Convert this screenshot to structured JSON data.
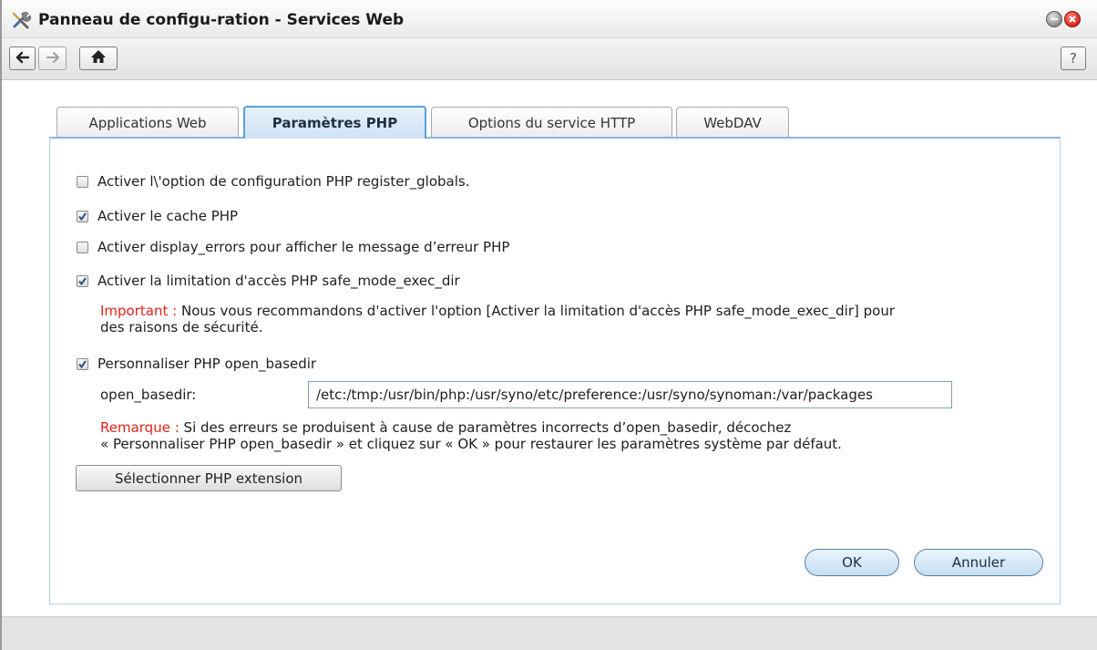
{
  "window": {
    "title": "Panneau de configu-ration - Services Web",
    "icon": "tools-icon",
    "controls": {
      "minimize_icon": "minimize-icon",
      "close_icon": "close-icon"
    }
  },
  "toolbar": {
    "back_icon": "arrow-left-icon",
    "forward_icon": "arrow-right-icon",
    "home_icon": "home-icon",
    "help_label": "?"
  },
  "tabs": [
    {
      "label": "Applications Web",
      "active": false
    },
    {
      "label": "Paramètres PHP",
      "active": true
    },
    {
      "label": "Options du service HTTP",
      "active": false
    },
    {
      "label": "WebDAV",
      "active": false
    }
  ],
  "options": [
    {
      "label": "Activer l\\'option de configuration PHP register_globals.",
      "checked": false
    },
    {
      "label": "Activer le cache PHP",
      "checked": true
    },
    {
      "label": "Activer display_errors pour afficher le message d’erreur PHP",
      "checked": false
    },
    {
      "label": "Activer la limitation d'accès PHP safe_mode_exec_dir",
      "checked": true
    },
    {
      "label": "Personnaliser PHP open_basedir",
      "checked": true
    }
  ],
  "important_note": {
    "lead": "Important :",
    "line1": "Nous vous recommandons d'activer l'option [Activer la limitation d'accès PHP safe_mode_exec_dir] pour",
    "line2": "des raisons de sécurité."
  },
  "open_basedir": {
    "label": "open_basedir:",
    "value": "/etc:/tmp:/usr/bin/php:/usr/syno/etc/preference:/usr/syno/synoman:/var/packages"
  },
  "remark_note": {
    "lead": "Remarque :",
    "line1": "Si des erreurs se produisent à cause de paramètres incorrects d’open_basedir, décochez",
    "line2": "« Personnaliser PHP open_basedir » et cliquez sur « OK » pour restaurer les paramètres système par défaut."
  },
  "buttons": {
    "select_extension": "Sélectionner PHP extension",
    "ok": "OK",
    "cancel": "Annuler"
  },
  "colors": {
    "accent": "#5aa0d8",
    "warning": "#e2231a"
  }
}
